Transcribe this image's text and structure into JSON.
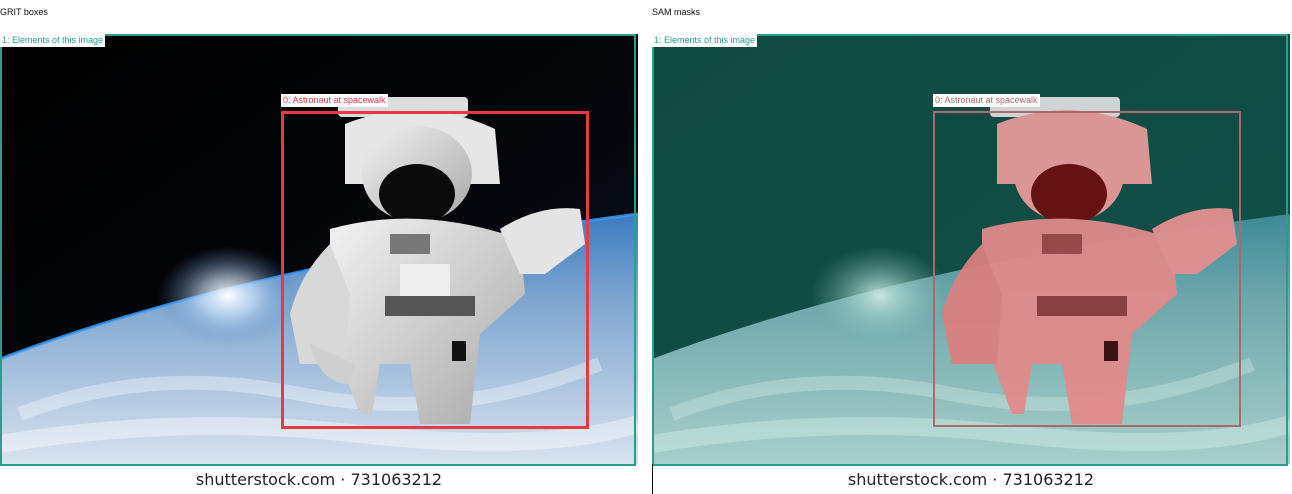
{
  "panels": [
    {
      "title": "GRIT boxes",
      "boxes": [
        {
          "label": "1: Elements of this image",
          "color": "#2a9d8f"
        },
        {
          "label": "0: Astronaut at spacewalk",
          "color": "#e63946"
        }
      ],
      "watermark": "shutterstock.com · 731063212"
    },
    {
      "title": "SAM masks",
      "boxes": [
        {
          "label": "1: Elements of this image",
          "color": "#2a9d8f"
        },
        {
          "label": "0: Astronaut at spacewalk",
          "color": "#a86a6a"
        }
      ],
      "watermark": "shutterstock.com · 731063212"
    }
  ],
  "colors": {
    "scene_box": "#2a9d8f",
    "astronaut_box": "#e63946",
    "scene_mask": "#0e6b5c",
    "astronaut_mask": "#e86a6a"
  }
}
